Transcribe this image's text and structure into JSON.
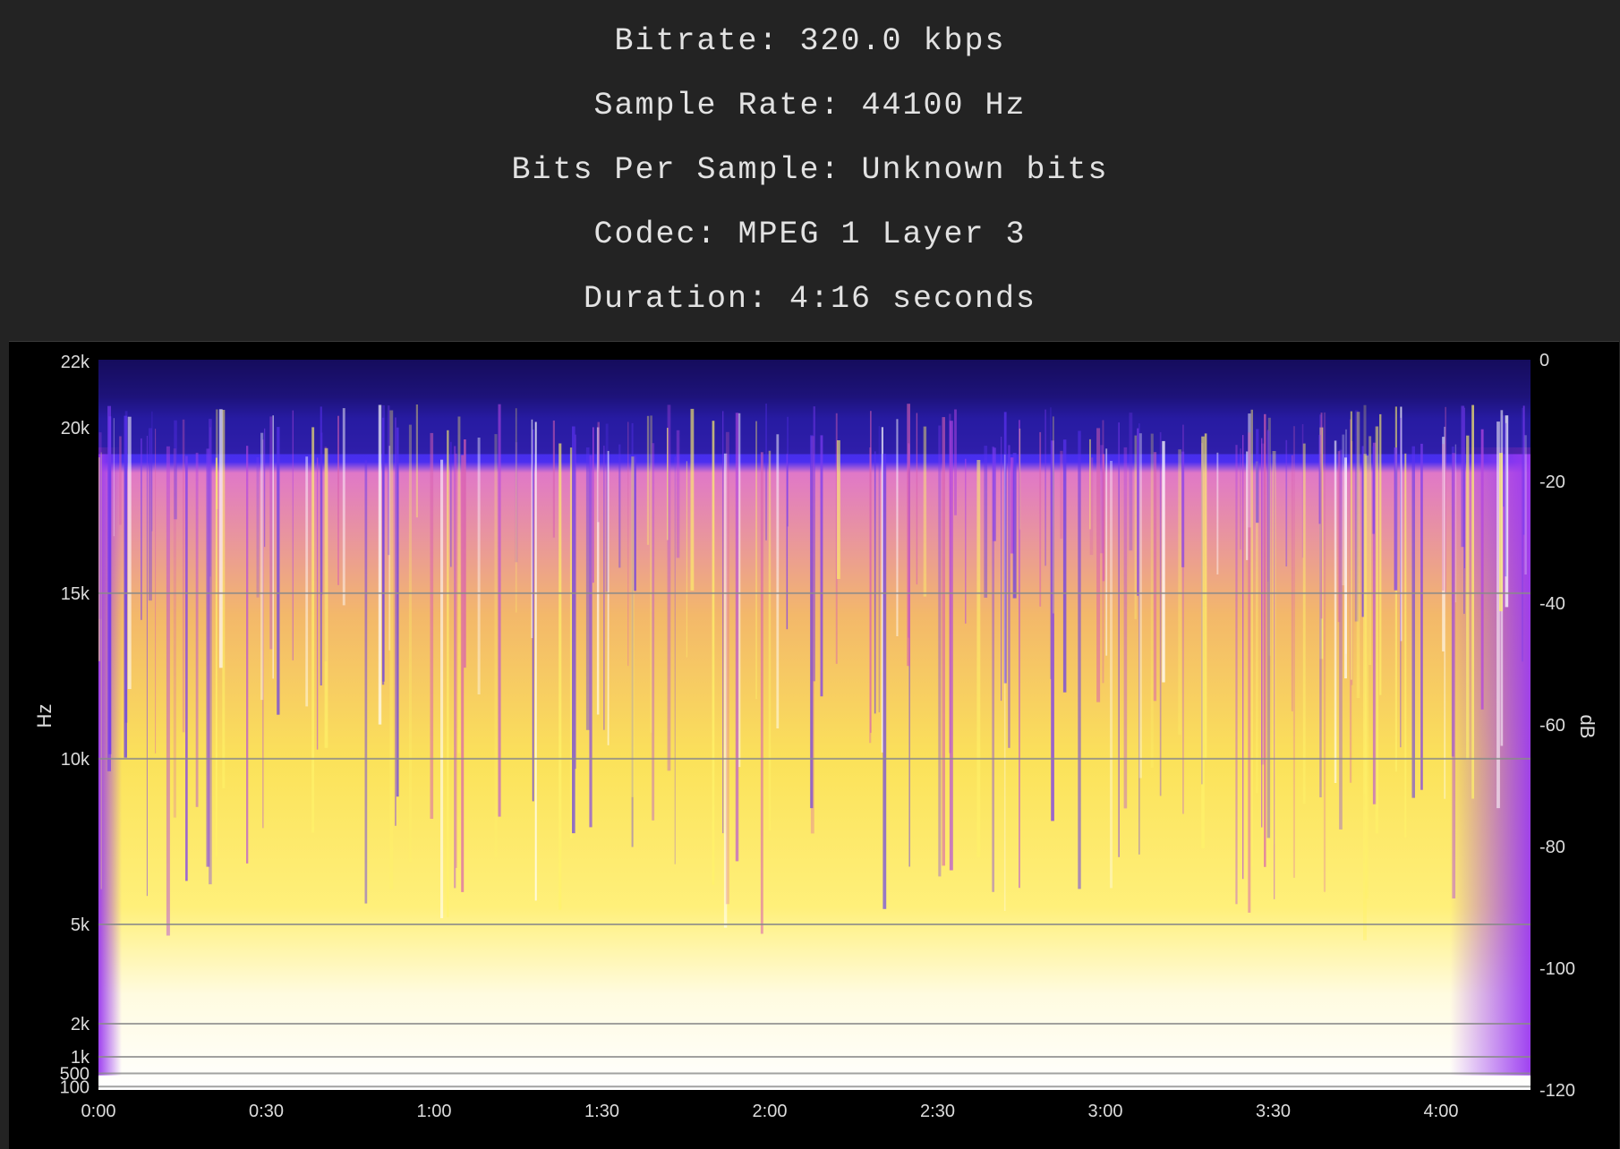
{
  "file_info": {
    "bitrate": "Bitrate: 320.0 kbps",
    "sample_rate": "Sample Rate: 44100 Hz",
    "bits_per_sample": "Bits Per Sample: Unknown bits",
    "codec": "Codec: MPEG 1 Layer 3",
    "duration": "Duration: 4:16 seconds"
  },
  "spectrogram": {
    "y_axis_title": "Hz",
    "db_axis_title": "dB",
    "colors": {
      "background": "#000000",
      "page_background": "#232323",
      "low": "#1a0a66",
      "mid_low": "#3b2cf0",
      "mid": "#a43df0",
      "mid_high": "#e879b8",
      "high": "#ffef3a",
      "peak": "#ffffff",
      "grid": "#8a8a8a"
    },
    "colormap_name": "spectrogram-colormap"
  },
  "chart_data": {
    "type": "heatmap",
    "title": "",
    "xlabel": "",
    "ylabel": "Hz",
    "x_ticks": [
      "0:00",
      "0:30",
      "1:00",
      "1:30",
      "2:00",
      "2:30",
      "3:00",
      "3:30",
      "4:00"
    ],
    "x_tick_seconds": [
      0,
      30,
      60,
      90,
      120,
      150,
      180,
      210,
      240
    ],
    "x_range_seconds": [
      0,
      256
    ],
    "y_ticks": [
      "22k",
      "20k",
      "15k",
      "10k",
      "5k",
      "2k",
      "1k",
      "500",
      "100"
    ],
    "y_tick_values": [
      22000,
      20000,
      15000,
      10000,
      5000,
      2000,
      1000,
      500,
      100
    ],
    "y_range_hz": [
      0,
      22050
    ],
    "db_ticks": [
      "0",
      "-20",
      "-40",
      "-60",
      "-80",
      "-100",
      "-120"
    ],
    "db_tick_values": [
      0,
      -20,
      -40,
      -60,
      -80,
      -100,
      -120
    ],
    "db_label": "dB",
    "lowpass_cutoff_hz": 19200,
    "grid": true
  }
}
